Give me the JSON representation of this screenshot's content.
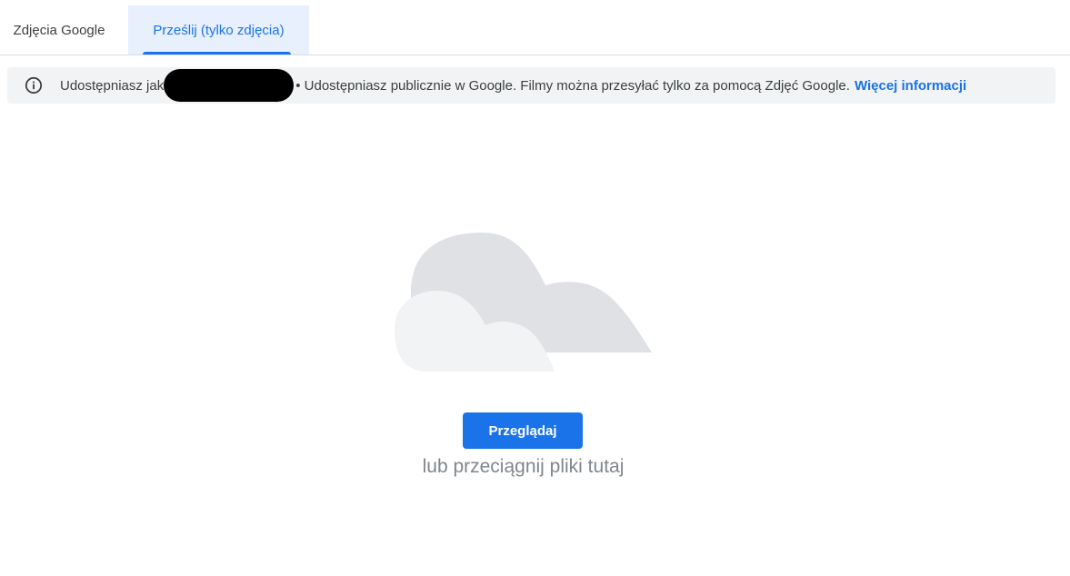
{
  "tabs": [
    {
      "label": "Zdjęcia Google",
      "active": false
    },
    {
      "label": "Prześlij (tylko zdjęcia)",
      "active": true
    }
  ],
  "banner": {
    "icon": "info-icon",
    "text_prefix": "Udostępniasz jak",
    "text_suffix": "• Udostępniasz publicznie w Google. Filmy można przesyłać tylko za pomocą Zdjęć Google.",
    "link_label": "Więcej informacji"
  },
  "upload": {
    "illustration": "cloud-illustration",
    "browse_label": "Przeglądaj",
    "drop_hint": "lub przeciągnij pliki tutaj"
  },
  "colors": {
    "accent": "#1a73e8",
    "active_tab_bg": "#e8f0fe",
    "banner_bg": "#f1f3f4",
    "cloud_back": "#dfe1e5",
    "cloud_front": "#f1f3f4"
  }
}
